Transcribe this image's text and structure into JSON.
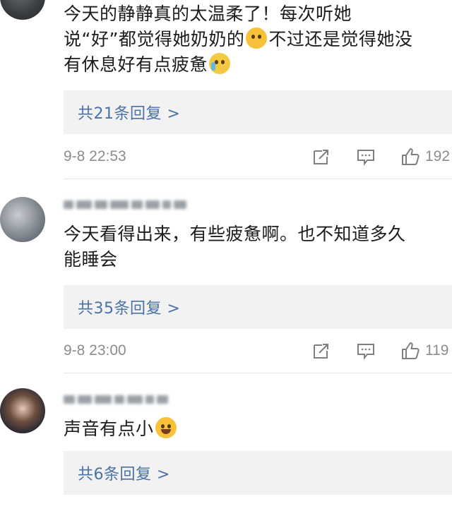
{
  "comments": [
    {
      "text": "今天的静静真的太温柔了！每次听她说“好”都觉得她奶奶的",
      "text_part1": "今天的静静真的太温柔了！每次听她\n说“好”都觉得她奶奶的",
      "text_part2": "不过还是觉得她没\n有休息好有点疲惫",
      "emoji1": "scream-emoji",
      "emoji2": "crying-emoji",
      "replies": "共21条回复 >",
      "time": "9-8 22:53",
      "likes": "192"
    },
    {
      "text": "今天看得出来，有些疲惫啊。也不知道多久\n能睡会",
      "replies": "共35条回复 >",
      "time": "9-8 23:00",
      "likes": "119"
    },
    {
      "text": "声音有点小",
      "emoji": "laughing-tears-emoji",
      "replies": "共6条回复 >"
    }
  ],
  "icons": {
    "share": "share-icon",
    "comment": "comment-icon",
    "like": "thumbs-up-icon"
  },
  "colors": {
    "link": "#4a72a8",
    "meta": "#8c8c8c",
    "reply_bg": "#f2f2f2"
  }
}
